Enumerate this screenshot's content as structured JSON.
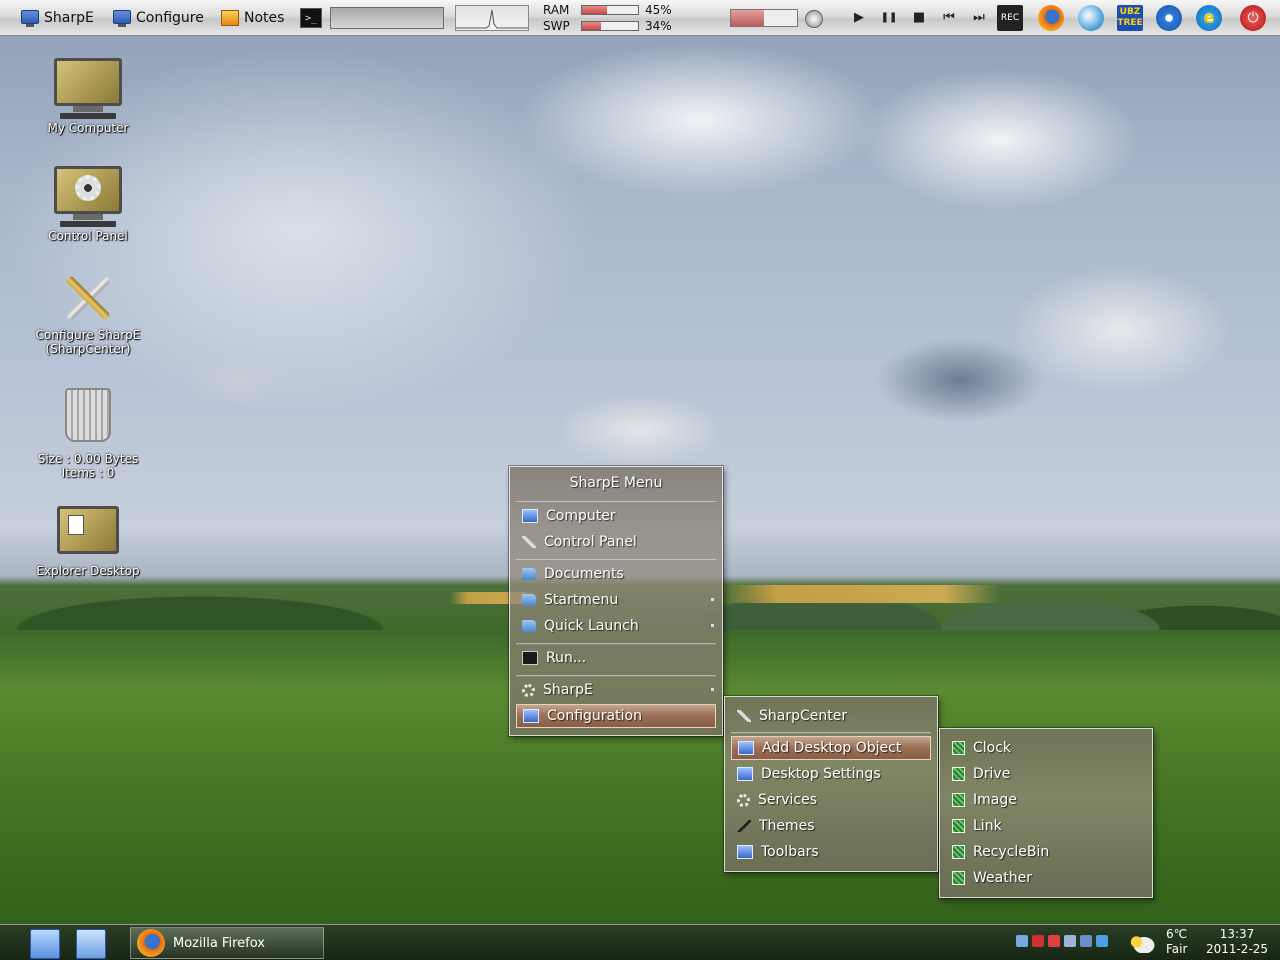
{
  "topbar": {
    "sharpe_label": "SharpE",
    "configure_label": "Configure",
    "notes_label": "Notes",
    "cmd_glyph": ">_",
    "ram_label": "RAM",
    "ram_pct_text": "45%",
    "ram_pct": 45,
    "swp_label": "SWP",
    "swp_pct_text": "34%",
    "swp_pct": 34,
    "volume_pct": 50,
    "media": {
      "play": "▶",
      "pause": "❚❚",
      "stop": "■",
      "prev": "⏮",
      "next": "⏭"
    },
    "rec_label": "REC",
    "tree_label": "UBZ TREE",
    "ie_glyph": "e",
    "power_glyph": "⏻"
  },
  "desktop_icons": [
    {
      "label": "My Computer",
      "icon": "computer-icon"
    },
    {
      "label": "Control Panel",
      "icon": "control-panel-icon"
    },
    {
      "label": "Configure SharpE",
      "label2": "(SharpCenter)",
      "icon": "tools-icon"
    },
    {
      "label": "Size : 0.00 Bytes",
      "label2": "Items : 0",
      "icon": "recycle-bin-icon"
    },
    {
      "label": "Explorer Desktop",
      "icon": "explorer-desktop-icon"
    }
  ],
  "main_menu": {
    "title": "SharpE Menu",
    "items": [
      {
        "label": "Computer",
        "icon": "computer-icon"
      },
      {
        "label": "Control Panel",
        "icon": "tool-icon"
      },
      {
        "label": "Documents",
        "icon": "folder-icon"
      },
      {
        "label": "Startmenu",
        "icon": "folder-icon"
      },
      {
        "label": "Quick Launch",
        "icon": "folder-icon"
      },
      {
        "label": "Run...",
        "icon": "run-icon"
      },
      {
        "label": "SharpE",
        "icon": "gear-icon"
      },
      {
        "label": "Configuration",
        "icon": "computer-icon"
      }
    ]
  },
  "config_menu": {
    "items": [
      {
        "label": "SharpCenter",
        "icon": "tool-icon"
      },
      {
        "label": "Add Desktop Object",
        "icon": "computer-icon"
      },
      {
        "label": "Desktop Settings",
        "icon": "computer-icon"
      },
      {
        "label": "Services",
        "icon": "gear-icon"
      },
      {
        "label": "Themes",
        "icon": "brush-icon"
      },
      {
        "label": "Toolbars",
        "icon": "computer-icon"
      }
    ]
  },
  "object_menu": {
    "items": [
      {
        "label": "Clock"
      },
      {
        "label": "Drive"
      },
      {
        "label": "Image"
      },
      {
        "label": "Link"
      },
      {
        "label": "RecycleBin"
      },
      {
        "label": "Weather"
      }
    ]
  },
  "taskbar": {
    "task_label": "Mozilla Firefox",
    "weather_temp": "6℃",
    "weather_cond": "Fair",
    "time": "13:37",
    "date": "2011-2-25"
  }
}
